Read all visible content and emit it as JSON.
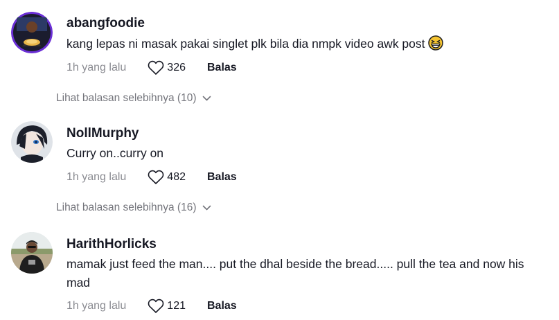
{
  "comments": [
    {
      "username": "abangfoodie",
      "text": "kang lepas ni masak pakai singlet plk bila dia nmpk video awk post",
      "emoji": "grinning-squinting-face-emoji",
      "time": "1h yang lalu",
      "likes": "326",
      "reply_label": "Balas",
      "more_replies": "Lihat balasan selebihnya (10)"
    },
    {
      "username": "NollMurphy",
      "text": "Curry on..curry on",
      "time": "1h yang lalu",
      "likes": "482",
      "reply_label": "Balas",
      "more_replies": "Lihat balasan selebihnya (16)"
    },
    {
      "username": "HarithHorlicks",
      "text": "mamak just feed the man.... put the dhal beside the bread..... pull the tea and now his mad",
      "time": "1h yang lalu",
      "likes": "121",
      "reply_label": "Balas"
    }
  ],
  "icons": {
    "like": "heart-outline-icon",
    "expand": "chevron-down-icon"
  },
  "colors": {
    "primary_text": "#161823",
    "secondary_text": "#8a8b91",
    "link_text": "#73747b",
    "avatar1_ring": "#6b2fd6"
  }
}
